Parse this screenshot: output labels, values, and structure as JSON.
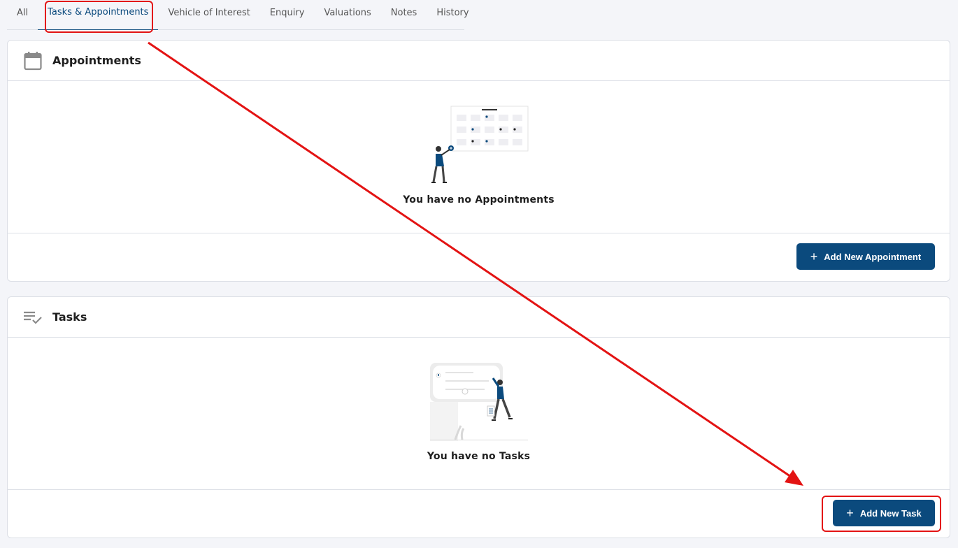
{
  "tabs": [
    {
      "label": "All",
      "active": false
    },
    {
      "label": "Tasks & Appointments",
      "active": true
    },
    {
      "label": "Vehicle of Interest",
      "active": false
    },
    {
      "label": "Enquiry",
      "active": false
    },
    {
      "label": "Valuations",
      "active": false
    },
    {
      "label": "Notes",
      "active": false
    },
    {
      "label": "History",
      "active": false
    }
  ],
  "appointments": {
    "title": "Appointments",
    "icon": "calendar-icon",
    "empty_message": "You have no Appointments",
    "add_button": "Add New Appointment"
  },
  "tasks": {
    "title": "Tasks",
    "icon": "checklist-icon",
    "empty_message": "You have no Tasks",
    "add_button": "Add New Task"
  },
  "colors": {
    "accent": "#0b4a7d",
    "annotation": "#e31313",
    "background": "#f4f5f9"
  }
}
